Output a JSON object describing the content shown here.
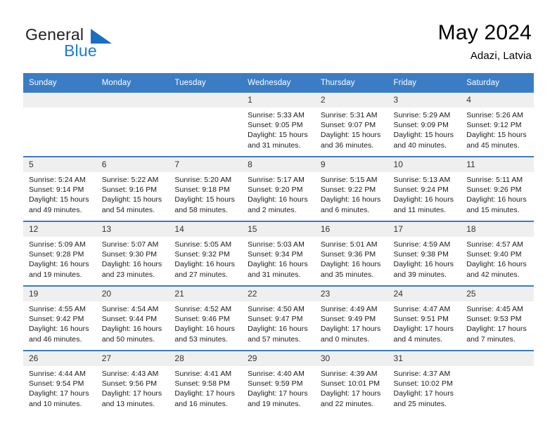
{
  "brand": {
    "name_part1": "General",
    "name_part2": "Blue",
    "triangle_icon": "triangle-icon",
    "colors": {
      "dark": "#231f20",
      "blue": "#1b7ad6",
      "triangle": "#1b6ec2"
    }
  },
  "header": {
    "title": "May 2024",
    "location": "Adazi, Latvia"
  },
  "theme": {
    "header_bg": "#3b7dc4",
    "daynum_bg": "#efefef",
    "row_rule": "#3b7dc4"
  },
  "weekday_headers": [
    "Sunday",
    "Monday",
    "Tuesday",
    "Wednesday",
    "Thursday",
    "Friday",
    "Saturday"
  ],
  "weeks": [
    [
      {
        "day": "",
        "lines": []
      },
      {
        "day": "",
        "lines": []
      },
      {
        "day": "",
        "lines": []
      },
      {
        "day": "1",
        "lines": [
          "Sunrise: 5:33 AM",
          "Sunset: 9:05 PM",
          "Daylight: 15 hours",
          "and 31 minutes."
        ]
      },
      {
        "day": "2",
        "lines": [
          "Sunrise: 5:31 AM",
          "Sunset: 9:07 PM",
          "Daylight: 15 hours",
          "and 36 minutes."
        ]
      },
      {
        "day": "3",
        "lines": [
          "Sunrise: 5:29 AM",
          "Sunset: 9:09 PM",
          "Daylight: 15 hours",
          "and 40 minutes."
        ]
      },
      {
        "day": "4",
        "lines": [
          "Sunrise: 5:26 AM",
          "Sunset: 9:12 PM",
          "Daylight: 15 hours",
          "and 45 minutes."
        ]
      }
    ],
    [
      {
        "day": "5",
        "lines": [
          "Sunrise: 5:24 AM",
          "Sunset: 9:14 PM",
          "Daylight: 15 hours",
          "and 49 minutes."
        ]
      },
      {
        "day": "6",
        "lines": [
          "Sunrise: 5:22 AM",
          "Sunset: 9:16 PM",
          "Daylight: 15 hours",
          "and 54 minutes."
        ]
      },
      {
        "day": "7",
        "lines": [
          "Sunrise: 5:20 AM",
          "Sunset: 9:18 PM",
          "Daylight: 15 hours",
          "and 58 minutes."
        ]
      },
      {
        "day": "8",
        "lines": [
          "Sunrise: 5:17 AM",
          "Sunset: 9:20 PM",
          "Daylight: 16 hours",
          "and 2 minutes."
        ]
      },
      {
        "day": "9",
        "lines": [
          "Sunrise: 5:15 AM",
          "Sunset: 9:22 PM",
          "Daylight: 16 hours",
          "and 6 minutes."
        ]
      },
      {
        "day": "10",
        "lines": [
          "Sunrise: 5:13 AM",
          "Sunset: 9:24 PM",
          "Daylight: 16 hours",
          "and 11 minutes."
        ]
      },
      {
        "day": "11",
        "lines": [
          "Sunrise: 5:11 AM",
          "Sunset: 9:26 PM",
          "Daylight: 16 hours",
          "and 15 minutes."
        ]
      }
    ],
    [
      {
        "day": "12",
        "lines": [
          "Sunrise: 5:09 AM",
          "Sunset: 9:28 PM",
          "Daylight: 16 hours",
          "and 19 minutes."
        ]
      },
      {
        "day": "13",
        "lines": [
          "Sunrise: 5:07 AM",
          "Sunset: 9:30 PM",
          "Daylight: 16 hours",
          "and 23 minutes."
        ]
      },
      {
        "day": "14",
        "lines": [
          "Sunrise: 5:05 AM",
          "Sunset: 9:32 PM",
          "Daylight: 16 hours",
          "and 27 minutes."
        ]
      },
      {
        "day": "15",
        "lines": [
          "Sunrise: 5:03 AM",
          "Sunset: 9:34 PM",
          "Daylight: 16 hours",
          "and 31 minutes."
        ]
      },
      {
        "day": "16",
        "lines": [
          "Sunrise: 5:01 AM",
          "Sunset: 9:36 PM",
          "Daylight: 16 hours",
          "and 35 minutes."
        ]
      },
      {
        "day": "17",
        "lines": [
          "Sunrise: 4:59 AM",
          "Sunset: 9:38 PM",
          "Daylight: 16 hours",
          "and 39 minutes."
        ]
      },
      {
        "day": "18",
        "lines": [
          "Sunrise: 4:57 AM",
          "Sunset: 9:40 PM",
          "Daylight: 16 hours",
          "and 42 minutes."
        ]
      }
    ],
    [
      {
        "day": "19",
        "lines": [
          "Sunrise: 4:55 AM",
          "Sunset: 9:42 PM",
          "Daylight: 16 hours",
          "and 46 minutes."
        ]
      },
      {
        "day": "20",
        "lines": [
          "Sunrise: 4:54 AM",
          "Sunset: 9:44 PM",
          "Daylight: 16 hours",
          "and 50 minutes."
        ]
      },
      {
        "day": "21",
        "lines": [
          "Sunrise: 4:52 AM",
          "Sunset: 9:46 PM",
          "Daylight: 16 hours",
          "and 53 minutes."
        ]
      },
      {
        "day": "22",
        "lines": [
          "Sunrise: 4:50 AM",
          "Sunset: 9:47 PM",
          "Daylight: 16 hours",
          "and 57 minutes."
        ]
      },
      {
        "day": "23",
        "lines": [
          "Sunrise: 4:49 AM",
          "Sunset: 9:49 PM",
          "Daylight: 17 hours",
          "and 0 minutes."
        ]
      },
      {
        "day": "24",
        "lines": [
          "Sunrise: 4:47 AM",
          "Sunset: 9:51 PM",
          "Daylight: 17 hours",
          "and 4 minutes."
        ]
      },
      {
        "day": "25",
        "lines": [
          "Sunrise: 4:45 AM",
          "Sunset: 9:53 PM",
          "Daylight: 17 hours",
          "and 7 minutes."
        ]
      }
    ],
    [
      {
        "day": "26",
        "lines": [
          "Sunrise: 4:44 AM",
          "Sunset: 9:54 PM",
          "Daylight: 17 hours",
          "and 10 minutes."
        ]
      },
      {
        "day": "27",
        "lines": [
          "Sunrise: 4:43 AM",
          "Sunset: 9:56 PM",
          "Daylight: 17 hours",
          "and 13 minutes."
        ]
      },
      {
        "day": "28",
        "lines": [
          "Sunrise: 4:41 AM",
          "Sunset: 9:58 PM",
          "Daylight: 17 hours",
          "and 16 minutes."
        ]
      },
      {
        "day": "29",
        "lines": [
          "Sunrise: 4:40 AM",
          "Sunset: 9:59 PM",
          "Daylight: 17 hours",
          "and 19 minutes."
        ]
      },
      {
        "day": "30",
        "lines": [
          "Sunrise: 4:39 AM",
          "Sunset: 10:01 PM",
          "Daylight: 17 hours",
          "and 22 minutes."
        ]
      },
      {
        "day": "31",
        "lines": [
          "Sunrise: 4:37 AM",
          "Sunset: 10:02 PM",
          "Daylight: 17 hours",
          "and 25 minutes."
        ]
      },
      {
        "day": "",
        "lines": []
      }
    ]
  ]
}
